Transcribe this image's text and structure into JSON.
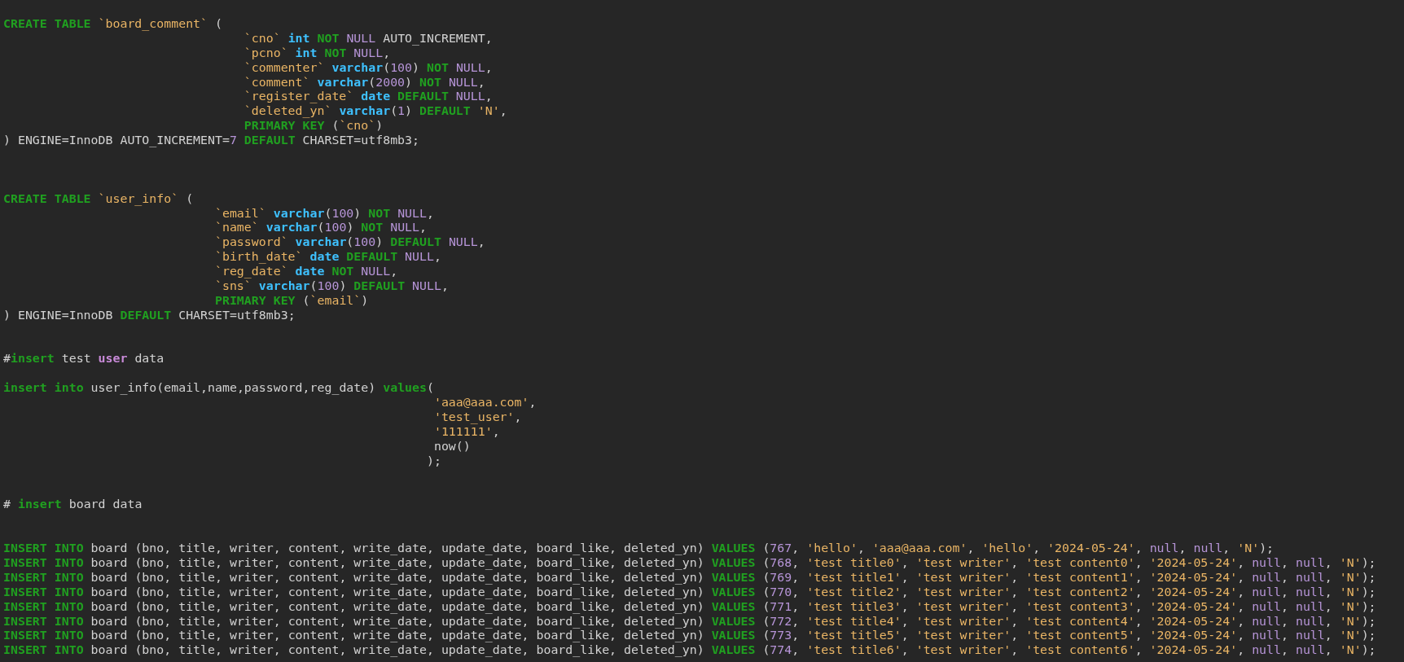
{
  "editor": {
    "lines": [
      {
        "kind": "table_open",
        "tokens": [
          {
            "kind": "keyword",
            "text": "CREATE TABLE "
          },
          {
            "kind": "string",
            "text": "`board_comment`"
          },
          {
            "kind": "plain",
            "text": " ("
          }
        ],
        "children": [
          {
            "kind": "code",
            "tokens": [
              {
                "kind": "string",
                "text": "`cno` "
              },
              {
                "kind": "type",
                "text": "int "
              },
              {
                "kind": "keyword",
                "text": "NOT "
              },
              {
                "kind": "number",
                "text": "NULL "
              },
              {
                "kind": "plain",
                "text": "AUTO_INCREMENT,"
              }
            ]
          },
          {
            "kind": "code",
            "tokens": [
              {
                "kind": "string",
                "text": "`pcno` "
              },
              {
                "kind": "type",
                "text": "int "
              },
              {
                "kind": "keyword",
                "text": "NOT "
              },
              {
                "kind": "number",
                "text": "NULL"
              },
              {
                "kind": "plain",
                "text": ","
              }
            ]
          },
          {
            "kind": "code",
            "tokens": [
              {
                "kind": "string",
                "text": "`commenter` "
              },
              {
                "kind": "type",
                "text": "varchar"
              },
              {
                "kind": "plain",
                "text": "("
              },
              {
                "kind": "number",
                "text": "100"
              },
              {
                "kind": "plain",
                "text": ") "
              },
              {
                "kind": "keyword",
                "text": "NOT "
              },
              {
                "kind": "number",
                "text": "NULL"
              },
              {
                "kind": "plain",
                "text": ","
              }
            ]
          },
          {
            "kind": "code",
            "tokens": [
              {
                "kind": "string",
                "text": "`comment` "
              },
              {
                "kind": "type",
                "text": "varchar"
              },
              {
                "kind": "plain",
                "text": "("
              },
              {
                "kind": "number",
                "text": "2000"
              },
              {
                "kind": "plain",
                "text": ") "
              },
              {
                "kind": "keyword",
                "text": "NOT "
              },
              {
                "kind": "number",
                "text": "NULL"
              },
              {
                "kind": "plain",
                "text": ","
              }
            ]
          },
          {
            "kind": "code",
            "tokens": [
              {
                "kind": "string",
                "text": "`register_date` "
              },
              {
                "kind": "type",
                "text": "date "
              },
              {
                "kind": "keyword",
                "text": "DEFAULT "
              },
              {
                "kind": "number",
                "text": "NULL"
              },
              {
                "kind": "plain",
                "text": ","
              }
            ]
          },
          {
            "kind": "code",
            "tokens": [
              {
                "kind": "string",
                "text": "`deleted_yn` "
              },
              {
                "kind": "type",
                "text": "varchar"
              },
              {
                "kind": "plain",
                "text": "("
              },
              {
                "kind": "number",
                "text": "1"
              },
              {
                "kind": "plain",
                "text": ") "
              },
              {
                "kind": "keyword",
                "text": "DEFAULT "
              },
              {
                "kind": "string",
                "text": "'N'"
              },
              {
                "kind": "plain",
                "text": ","
              }
            ]
          },
          {
            "kind": "code",
            "tokens": [
              {
                "kind": "keyword",
                "text": "PRIMARY KEY "
              },
              {
                "kind": "plain",
                "text": "("
              },
              {
                "kind": "string",
                "text": "`cno`"
              },
              {
                "kind": "plain",
                "text": ")"
              }
            ]
          }
        ]
      },
      {
        "kind": "code",
        "tokens": [
          {
            "kind": "plain",
            "text": ") ENGINE=InnoDB AUTO_INCREMENT="
          },
          {
            "kind": "number",
            "text": "7"
          },
          {
            "kind": "keyword",
            "text": " DEFAULT "
          },
          {
            "kind": "plain",
            "text": "CHARSET=utf8mb3;"
          }
        ]
      },
      {
        "kind": "blank"
      },
      {
        "kind": "blank"
      },
      {
        "kind": "blank"
      },
      {
        "kind": "table_open",
        "tokens": [
          {
            "kind": "keyword",
            "text": "CREATE TABLE "
          },
          {
            "kind": "string",
            "text": "`user_info`"
          },
          {
            "kind": "plain",
            "text": " ("
          }
        ],
        "children": [
          {
            "kind": "code",
            "tokens": [
              {
                "kind": "string",
                "text": "`email` "
              },
              {
                "kind": "type",
                "text": "varchar"
              },
              {
                "kind": "plain",
                "text": "("
              },
              {
                "kind": "number",
                "text": "100"
              },
              {
                "kind": "plain",
                "text": ") "
              },
              {
                "kind": "keyword",
                "text": "NOT "
              },
              {
                "kind": "number",
                "text": "NULL"
              },
              {
                "kind": "plain",
                "text": ","
              }
            ]
          },
          {
            "kind": "code",
            "tokens": [
              {
                "kind": "string",
                "text": "`name` "
              },
              {
                "kind": "type",
                "text": "varchar"
              },
              {
                "kind": "plain",
                "text": "("
              },
              {
                "kind": "number",
                "text": "100"
              },
              {
                "kind": "plain",
                "text": ") "
              },
              {
                "kind": "keyword",
                "text": "NOT "
              },
              {
                "kind": "number",
                "text": "NULL"
              },
              {
                "kind": "plain",
                "text": ","
              }
            ]
          },
          {
            "kind": "code",
            "tokens": [
              {
                "kind": "string",
                "text": "`password` "
              },
              {
                "kind": "type",
                "text": "varchar"
              },
              {
                "kind": "plain",
                "text": "("
              },
              {
                "kind": "number",
                "text": "100"
              },
              {
                "kind": "plain",
                "text": ") "
              },
              {
                "kind": "keyword",
                "text": "DEFAULT "
              },
              {
                "kind": "number",
                "text": "NULL"
              },
              {
                "kind": "plain",
                "text": ","
              }
            ]
          },
          {
            "kind": "code",
            "tokens": [
              {
                "kind": "string",
                "text": "`birth_date` "
              },
              {
                "kind": "type",
                "text": "date "
              },
              {
                "kind": "keyword",
                "text": "DEFAULT "
              },
              {
                "kind": "number",
                "text": "NULL"
              },
              {
                "kind": "plain",
                "text": ","
              }
            ]
          },
          {
            "kind": "code",
            "tokens": [
              {
                "kind": "string",
                "text": "`reg_date` "
              },
              {
                "kind": "type",
                "text": "date "
              },
              {
                "kind": "keyword",
                "text": "NOT "
              },
              {
                "kind": "number",
                "text": "NULL"
              },
              {
                "kind": "plain",
                "text": ","
              }
            ]
          },
          {
            "kind": "code",
            "tokens": [
              {
                "kind": "string",
                "text": "`sns` "
              },
              {
                "kind": "type",
                "text": "varchar"
              },
              {
                "kind": "plain",
                "text": "("
              },
              {
                "kind": "number",
                "text": "100"
              },
              {
                "kind": "plain",
                "text": ") "
              },
              {
                "kind": "keyword",
                "text": "DEFAULT "
              },
              {
                "kind": "number",
                "text": "NULL"
              },
              {
                "kind": "plain",
                "text": ","
              }
            ]
          },
          {
            "kind": "code",
            "tokens": [
              {
                "kind": "keyword",
                "text": "PRIMARY KEY "
              },
              {
                "kind": "plain",
                "text": "("
              },
              {
                "kind": "string",
                "text": "`email`"
              },
              {
                "kind": "plain",
                "text": ")"
              }
            ]
          }
        ]
      },
      {
        "kind": "code",
        "tokens": [
          {
            "kind": "plain",
            "text": ") ENGINE=InnoDB "
          },
          {
            "kind": "keyword",
            "text": "DEFAULT "
          },
          {
            "kind": "plain",
            "text": "CHARSET=utf8mb3;"
          }
        ]
      },
      {
        "kind": "blank"
      },
      {
        "kind": "blank"
      },
      {
        "kind": "code",
        "tokens": [
          {
            "kind": "plain",
            "text": "#"
          },
          {
            "kind": "keyword",
            "text": "insert "
          },
          {
            "kind": "plain",
            "text": "test "
          },
          {
            "kind": "special",
            "text": "user "
          },
          {
            "kind": "plain",
            "text": "data"
          }
        ]
      },
      {
        "kind": "blank"
      },
      {
        "kind": "call_open",
        "tokens": [
          {
            "kind": "keyword",
            "text": "insert into "
          },
          {
            "kind": "plain",
            "text": "user_info(email,name,password,reg_date) "
          },
          {
            "kind": "keyword",
            "text": "values"
          },
          {
            "kind": "plain",
            "text": "("
          }
        ],
        "children": [
          {
            "kind": "code",
            "tokens": [
              {
                "kind": "string",
                "text": "'aaa@aaa.com'"
              },
              {
                "kind": "plain",
                "text": ","
              }
            ]
          },
          {
            "kind": "code",
            "tokens": [
              {
                "kind": "string",
                "text": "'test_user'"
              },
              {
                "kind": "plain",
                "text": ","
              }
            ]
          },
          {
            "kind": "code",
            "tokens": [
              {
                "kind": "string",
                "text": "'111111'"
              },
              {
                "kind": "plain",
                "text": ","
              }
            ]
          },
          {
            "kind": "code",
            "tokens": [
              {
                "kind": "plain",
                "text": "now()"
              }
            ]
          },
          {
            "kind": "close",
            "tokens": [
              {
                "kind": "plain",
                "text": ");"
              }
            ]
          }
        ]
      },
      {
        "kind": "blank"
      },
      {
        "kind": "blank"
      },
      {
        "kind": "code",
        "tokens": [
          {
            "kind": "plain",
            "text": "# "
          },
          {
            "kind": "keyword",
            "text": "insert "
          },
          {
            "kind": "plain",
            "text": "board data"
          }
        ]
      },
      {
        "kind": "blank"
      },
      {
        "kind": "blank"
      },
      {
        "kind": "code",
        "tokens": [
          {
            "kind": "keyword",
            "text": "INSERT INTO "
          },
          {
            "kind": "plain",
            "text": "board (bno, title, writer, content, write_date, update_date, board_like, deleted_yn) "
          },
          {
            "kind": "keyword",
            "text": "VALUES "
          },
          {
            "kind": "plain",
            "text": "("
          },
          {
            "kind": "number",
            "text": "767"
          },
          {
            "kind": "plain",
            "text": ", "
          },
          {
            "kind": "string",
            "text": "'hello'"
          },
          {
            "kind": "plain",
            "text": ", "
          },
          {
            "kind": "string",
            "text": "'aaa@aaa.com'"
          },
          {
            "kind": "plain",
            "text": ", "
          },
          {
            "kind": "string",
            "text": "'hello'"
          },
          {
            "kind": "plain",
            "text": ", "
          },
          {
            "kind": "string",
            "text": "'2024-05-24'"
          },
          {
            "kind": "plain",
            "text": ", "
          },
          {
            "kind": "number",
            "text": "null"
          },
          {
            "kind": "plain",
            "text": ", "
          },
          {
            "kind": "number",
            "text": "null"
          },
          {
            "kind": "plain",
            "text": ", "
          },
          {
            "kind": "string",
            "text": "'N'"
          },
          {
            "kind": "plain",
            "text": ");"
          }
        ]
      },
      {
        "kind": "code",
        "tokens": [
          {
            "kind": "keyword",
            "text": "INSERT INTO "
          },
          {
            "kind": "plain",
            "text": "board (bno, title, writer, content, write_date, update_date, board_like, deleted_yn) "
          },
          {
            "kind": "keyword",
            "text": "VALUES "
          },
          {
            "kind": "plain",
            "text": "("
          },
          {
            "kind": "number",
            "text": "768"
          },
          {
            "kind": "plain",
            "text": ", "
          },
          {
            "kind": "string",
            "text": "'test title0'"
          },
          {
            "kind": "plain",
            "text": ", "
          },
          {
            "kind": "string",
            "text": "'test writer'"
          },
          {
            "kind": "plain",
            "text": ", "
          },
          {
            "kind": "string",
            "text": "'test content0'"
          },
          {
            "kind": "plain",
            "text": ", "
          },
          {
            "kind": "string",
            "text": "'2024-05-24'"
          },
          {
            "kind": "plain",
            "text": ", "
          },
          {
            "kind": "number",
            "text": "null"
          },
          {
            "kind": "plain",
            "text": ", "
          },
          {
            "kind": "number",
            "text": "null"
          },
          {
            "kind": "plain",
            "text": ", "
          },
          {
            "kind": "string",
            "text": "'N'"
          },
          {
            "kind": "plain",
            "text": ");"
          }
        ]
      },
      {
        "kind": "code",
        "tokens": [
          {
            "kind": "keyword",
            "text": "INSERT INTO "
          },
          {
            "kind": "plain",
            "text": "board (bno, title, writer, content, write_date, update_date, board_like, deleted_yn) "
          },
          {
            "kind": "keyword",
            "text": "VALUES "
          },
          {
            "kind": "plain",
            "text": "("
          },
          {
            "kind": "number",
            "text": "769"
          },
          {
            "kind": "plain",
            "text": ", "
          },
          {
            "kind": "string",
            "text": "'test title1'"
          },
          {
            "kind": "plain",
            "text": ", "
          },
          {
            "kind": "string",
            "text": "'test writer'"
          },
          {
            "kind": "plain",
            "text": ", "
          },
          {
            "kind": "string",
            "text": "'test content1'"
          },
          {
            "kind": "plain",
            "text": ", "
          },
          {
            "kind": "string",
            "text": "'2024-05-24'"
          },
          {
            "kind": "plain",
            "text": ", "
          },
          {
            "kind": "number",
            "text": "null"
          },
          {
            "kind": "plain",
            "text": ", "
          },
          {
            "kind": "number",
            "text": "null"
          },
          {
            "kind": "plain",
            "text": ", "
          },
          {
            "kind": "string",
            "text": "'N'"
          },
          {
            "kind": "plain",
            "text": ");"
          }
        ]
      },
      {
        "kind": "code",
        "tokens": [
          {
            "kind": "keyword",
            "text": "INSERT INTO "
          },
          {
            "kind": "plain",
            "text": "board (bno, title, writer, content, write_date, update_date, board_like, deleted_yn) "
          },
          {
            "kind": "keyword",
            "text": "VALUES "
          },
          {
            "kind": "plain",
            "text": "("
          },
          {
            "kind": "number",
            "text": "770"
          },
          {
            "kind": "plain",
            "text": ", "
          },
          {
            "kind": "string",
            "text": "'test title2'"
          },
          {
            "kind": "plain",
            "text": ", "
          },
          {
            "kind": "string",
            "text": "'test writer'"
          },
          {
            "kind": "plain",
            "text": ", "
          },
          {
            "kind": "string",
            "text": "'test content2'"
          },
          {
            "kind": "plain",
            "text": ", "
          },
          {
            "kind": "string",
            "text": "'2024-05-24'"
          },
          {
            "kind": "plain",
            "text": ", "
          },
          {
            "kind": "number",
            "text": "null"
          },
          {
            "kind": "plain",
            "text": ", "
          },
          {
            "kind": "number",
            "text": "null"
          },
          {
            "kind": "plain",
            "text": ", "
          },
          {
            "kind": "string",
            "text": "'N'"
          },
          {
            "kind": "plain",
            "text": ");"
          }
        ]
      },
      {
        "kind": "code",
        "tokens": [
          {
            "kind": "keyword",
            "text": "INSERT INTO "
          },
          {
            "kind": "plain",
            "text": "board (bno, title, writer, content, write_date, update_date, board_like, deleted_yn) "
          },
          {
            "kind": "keyword",
            "text": "VALUES "
          },
          {
            "kind": "plain",
            "text": "("
          },
          {
            "kind": "number",
            "text": "771"
          },
          {
            "kind": "plain",
            "text": ", "
          },
          {
            "kind": "string",
            "text": "'test title3'"
          },
          {
            "kind": "plain",
            "text": ", "
          },
          {
            "kind": "string",
            "text": "'test writer'"
          },
          {
            "kind": "plain",
            "text": ", "
          },
          {
            "kind": "string",
            "text": "'test content3'"
          },
          {
            "kind": "plain",
            "text": ", "
          },
          {
            "kind": "string",
            "text": "'2024-05-24'"
          },
          {
            "kind": "plain",
            "text": ", "
          },
          {
            "kind": "number",
            "text": "null"
          },
          {
            "kind": "plain",
            "text": ", "
          },
          {
            "kind": "number",
            "text": "null"
          },
          {
            "kind": "plain",
            "text": ", "
          },
          {
            "kind": "string",
            "text": "'N'"
          },
          {
            "kind": "plain",
            "text": ");"
          }
        ]
      },
      {
        "kind": "code",
        "tokens": [
          {
            "kind": "keyword",
            "text": "INSERT INTO "
          },
          {
            "kind": "plain",
            "text": "board (bno, title, writer, content, write_date, update_date, board_like, deleted_yn) "
          },
          {
            "kind": "keyword",
            "text": "VALUES "
          },
          {
            "kind": "plain",
            "text": "("
          },
          {
            "kind": "number",
            "text": "772"
          },
          {
            "kind": "plain",
            "text": ", "
          },
          {
            "kind": "string",
            "text": "'test title4'"
          },
          {
            "kind": "plain",
            "text": ", "
          },
          {
            "kind": "string",
            "text": "'test writer'"
          },
          {
            "kind": "plain",
            "text": ", "
          },
          {
            "kind": "string",
            "text": "'test content4'"
          },
          {
            "kind": "plain",
            "text": ", "
          },
          {
            "kind": "string",
            "text": "'2024-05-24'"
          },
          {
            "kind": "plain",
            "text": ", "
          },
          {
            "kind": "number",
            "text": "null"
          },
          {
            "kind": "plain",
            "text": ", "
          },
          {
            "kind": "number",
            "text": "null"
          },
          {
            "kind": "plain",
            "text": ", "
          },
          {
            "kind": "string",
            "text": "'N'"
          },
          {
            "kind": "plain",
            "text": ");"
          }
        ]
      },
      {
        "kind": "code",
        "tokens": [
          {
            "kind": "keyword",
            "text": "INSERT INTO "
          },
          {
            "kind": "plain",
            "text": "board (bno, title, writer, content, write_date, update_date, board_like, deleted_yn) "
          },
          {
            "kind": "keyword",
            "text": "VALUES "
          },
          {
            "kind": "plain",
            "text": "("
          },
          {
            "kind": "number",
            "text": "773"
          },
          {
            "kind": "plain",
            "text": ", "
          },
          {
            "kind": "string",
            "text": "'test title5'"
          },
          {
            "kind": "plain",
            "text": ", "
          },
          {
            "kind": "string",
            "text": "'test writer'"
          },
          {
            "kind": "plain",
            "text": ", "
          },
          {
            "kind": "string",
            "text": "'test content5'"
          },
          {
            "kind": "plain",
            "text": ", "
          },
          {
            "kind": "string",
            "text": "'2024-05-24'"
          },
          {
            "kind": "plain",
            "text": ", "
          },
          {
            "kind": "number",
            "text": "null"
          },
          {
            "kind": "plain",
            "text": ", "
          },
          {
            "kind": "number",
            "text": "null"
          },
          {
            "kind": "plain",
            "text": ", "
          },
          {
            "kind": "string",
            "text": "'N'"
          },
          {
            "kind": "plain",
            "text": ");"
          }
        ]
      },
      {
        "kind": "code",
        "tokens": [
          {
            "kind": "keyword",
            "text": "INSERT INTO "
          },
          {
            "kind": "plain",
            "text": "board (bno, title, writer, content, write_date, update_date, board_like, deleted_yn) "
          },
          {
            "kind": "keyword",
            "text": "VALUES "
          },
          {
            "kind": "plain",
            "text": "("
          },
          {
            "kind": "number",
            "text": "774"
          },
          {
            "kind": "plain",
            "text": ", "
          },
          {
            "kind": "string",
            "text": "'test title6'"
          },
          {
            "kind": "plain",
            "text": ", "
          },
          {
            "kind": "string",
            "text": "'test writer'"
          },
          {
            "kind": "plain",
            "text": ", "
          },
          {
            "kind": "string",
            "text": "'test content6'"
          },
          {
            "kind": "plain",
            "text": ", "
          },
          {
            "kind": "string",
            "text": "'2024-05-24'"
          },
          {
            "kind": "plain",
            "text": ", "
          },
          {
            "kind": "number",
            "text": "null"
          },
          {
            "kind": "plain",
            "text": ", "
          },
          {
            "kind": "number",
            "text": "null"
          },
          {
            "kind": "plain",
            "text": ", "
          },
          {
            "kind": "string",
            "text": "'N'"
          },
          {
            "kind": "plain",
            "text": ");"
          }
        ]
      }
    ]
  }
}
